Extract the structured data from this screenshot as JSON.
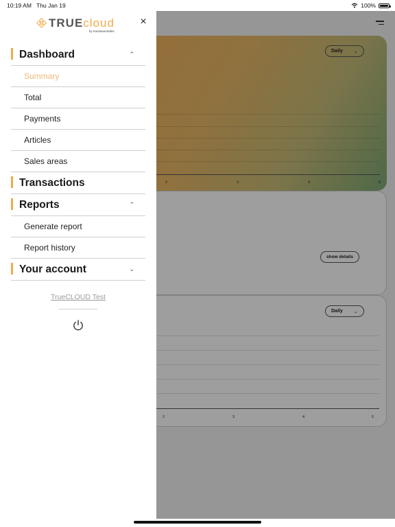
{
  "status_bar": {
    "time": "10:19 AM",
    "date": "Thu Jan 19",
    "battery": "100%"
  },
  "background": {
    "period_pill_1": "Daily",
    "period_pill_2": "Daily",
    "show_details": "show details",
    "ticks_top": [
      "2",
      "3",
      "4",
      "5"
    ],
    "ticks_bottom": [
      "2",
      "3",
      "4",
      "5"
    ]
  },
  "drawer": {
    "logo": {
      "text_a": "TRUE",
      "text_b": "cloud",
      "sub": "by Kassasentralen"
    },
    "sections": [
      {
        "label": "Dashboard",
        "chevron": "^",
        "items": [
          "Summary",
          "Total",
          "Payments",
          "Articles",
          "Sales areas"
        ]
      },
      {
        "label": "Transactions"
      },
      {
        "label": "Reports",
        "chevron": "^",
        "items": [
          "Generate report",
          "Report history"
        ]
      },
      {
        "label": "Your account",
        "chevron": "v"
      }
    ],
    "account_name": "TrueCLOUD Test"
  },
  "colors": {
    "accent": "#f2a94a",
    "active_item": "#f2b878",
    "divider": "#cfcfcf"
  },
  "icons": {
    "close": "close-icon",
    "power": "power-icon",
    "wifi": "wifi-icon",
    "battery": "battery-icon",
    "menu": "hamburger-icon"
  }
}
